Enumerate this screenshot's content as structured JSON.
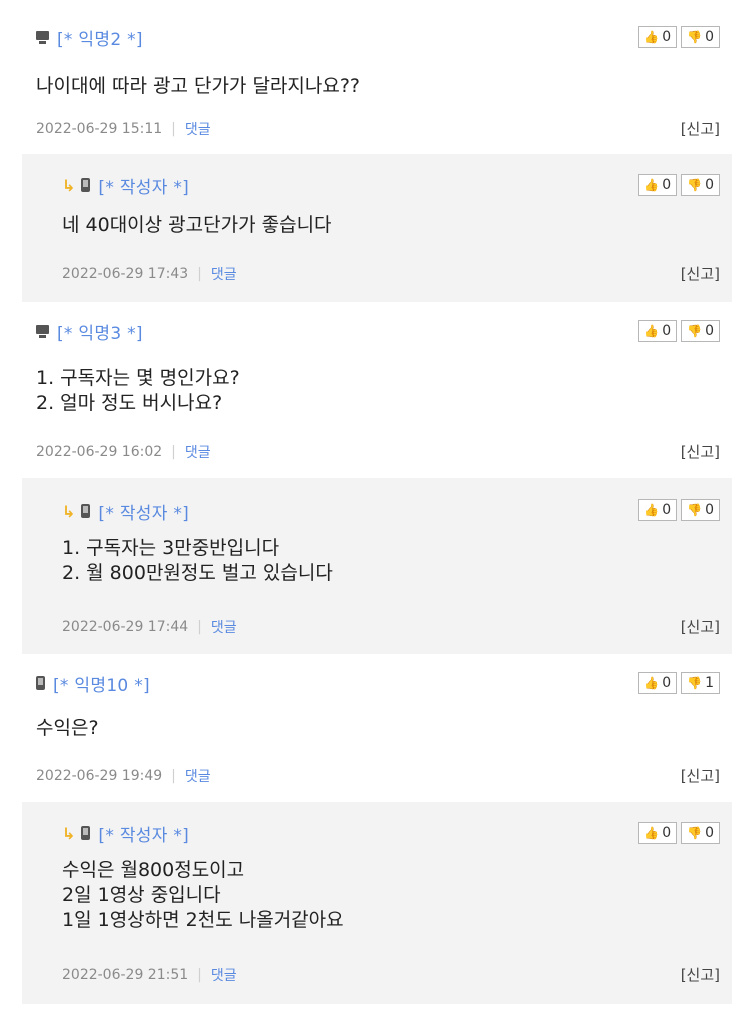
{
  "comments": [
    {
      "kind": "top",
      "device": "pc",
      "nickname": "[* 익명2 *]",
      "body": "나이대에 따라 광고 단가가 달라지나요??",
      "timestamp": "2022-06-29 15:11",
      "reply_label": "댓글",
      "report_label": "[신고]",
      "upvotes": "0",
      "downvotes": "0"
    },
    {
      "kind": "reply",
      "device": "mobile",
      "nickname": "[* 작성자 *]",
      "body": "네 40대이상 광고단가가 좋습니다",
      "timestamp": "2022-06-29 17:43",
      "reply_label": "댓글",
      "report_label": "[신고]",
      "upvotes": "0",
      "downvotes": "0"
    },
    {
      "kind": "top",
      "device": "pc",
      "nickname": "[* 익명3 *]",
      "body": "1. 구독자는 몇 명인가요?\n2. 얼마 정도 버시나요?",
      "timestamp": "2022-06-29 16:02",
      "reply_label": "댓글",
      "report_label": "[신고]",
      "upvotes": "0",
      "downvotes": "0"
    },
    {
      "kind": "reply",
      "device": "mobile",
      "nickname": "[* 작성자 *]",
      "body": "1. 구독자는 3만중반입니다\n2. 월 800만원정도 벌고 있습니다",
      "timestamp": "2022-06-29 17:44",
      "reply_label": "댓글",
      "report_label": "[신고]",
      "upvotes": "0",
      "downvotes": "0"
    },
    {
      "kind": "top",
      "device": "mobile",
      "nickname": "[* 익명10 *]",
      "body": "수익은?",
      "timestamp": "2022-06-29 19:49",
      "reply_label": "댓글",
      "report_label": "[신고]",
      "upvotes": "0",
      "downvotes": "1"
    },
    {
      "kind": "reply",
      "device": "mobile",
      "nickname": "[* 작성자 *]",
      "body": "수익은 월800정도이고\n2일 1영상 중입니다\n1일 1영상하면 2천도 나올거같아요",
      "timestamp": "2022-06-29 21:51",
      "reply_label": "댓글",
      "report_label": "[신고]",
      "upvotes": "0",
      "downvotes": "0"
    }
  ],
  "icons": {
    "reply_arrow": "reply-arrow-icon",
    "thumb_up": "thumbs-up-icon",
    "thumb_down": "thumbs-down-icon",
    "pc": "desktop-icon",
    "mobile": "mobile-phone-icon"
  },
  "colors": {
    "nickname": "#5a8ae0",
    "reply_bg": "#f3f3f3",
    "arrow": "#f0b429"
  }
}
